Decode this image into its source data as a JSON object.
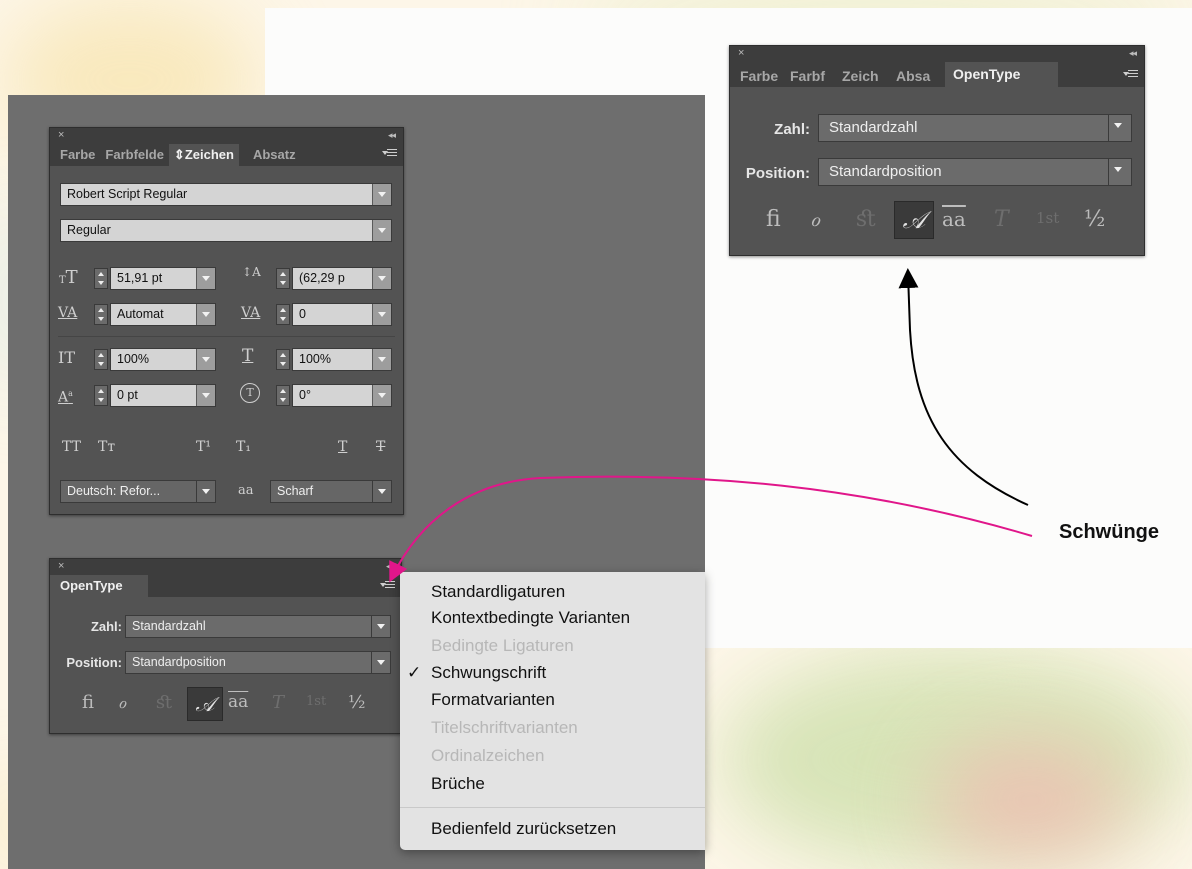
{
  "annotation": {
    "label": "Schwünge"
  },
  "zeichen_panel": {
    "tabs": [
      "Farbe",
      "Farbfelde",
      "⇕Zeichen",
      "Absatz"
    ],
    "font_family": "Robert Script Regular",
    "font_style": "Regular",
    "font_size": "51,91 pt",
    "leading": "(62,29 p",
    "kerning": "Automat",
    "tracking": "0",
    "vertical_scale": "100%",
    "horizontal_scale": "100%",
    "baseline_shift": "0 pt",
    "rotation": "0°",
    "language": "Deutsch: Refor...",
    "antialias_icon": "aa",
    "antialias": "Scharf",
    "glyphs": {
      "size_icon": "T",
      "leading_icon": "A",
      "kerning_icon": "VA",
      "tracking_icon": "VA",
      "vscale_icon": "IT",
      "hscale_icon": "T",
      "baseline_icon": "A",
      "rotation_icon": "T",
      "all_caps": "TT",
      "small_caps": "Tᴛ",
      "superscript": "T¹",
      "subscript": "T₁",
      "underline": "T",
      "strikethrough": "T"
    }
  },
  "opentype_bottom": {
    "tab": "OpenType",
    "zahl_label": "Zahl:",
    "zahl_value": "Standardzahl",
    "position_label": "Position:",
    "position_value": "Standardposition",
    "buttons": [
      "ﬁ",
      "ℴ",
      "ﬆ",
      "𝒜",
      "aa",
      "T",
      "1st",
      "½"
    ]
  },
  "opentype_top": {
    "tabs": [
      "Farbе",
      "Farbf",
      "Zeich",
      "Absa",
      "OpenType"
    ],
    "zahl_label": "Zahl:",
    "zahl_value": "Standardzahl",
    "position_label": "Position:",
    "position_value": "Standardposition",
    "buttons": [
      "ﬁ",
      "ℴ",
      "ﬆ",
      "𝒜",
      "aa",
      "T",
      "1st",
      "½"
    ]
  },
  "flyout_menu": {
    "items": [
      "Standardligaturen",
      "Kontextbedingte Varianten",
      "Bedingte Ligaturen",
      "Schwungschrift",
      "Formatvarianten",
      "Titelschriftvarianten",
      "Ordinalzeichen",
      "Brüche",
      "Bedienfeld zurücksetzen"
    ],
    "checkmark": "✓"
  },
  "colors": {
    "arrow_pink": "#e0168a",
    "arrow_black": "#000000",
    "panel_bg": "#535353"
  }
}
